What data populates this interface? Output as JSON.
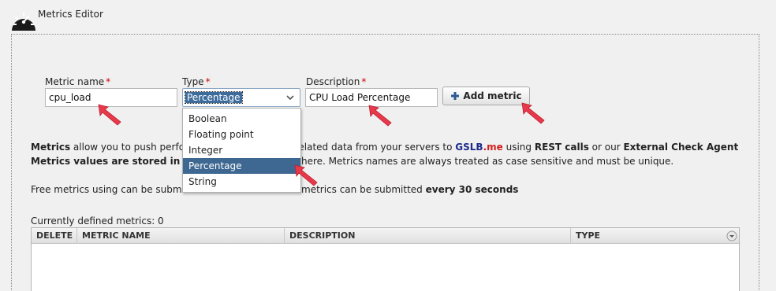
{
  "app": {
    "title": "Metrics Editor",
    "icon": "gauge-icon"
  },
  "form": {
    "metric_name": {
      "label": "Metric name",
      "required_mark": "*",
      "value": "cpu_load"
    },
    "type": {
      "label": "Type",
      "required_mark": "*",
      "value": "Percentage",
      "options": [
        "Boolean",
        "Floating point",
        "Integer",
        "Percentage",
        "String"
      ],
      "selected_option": "Percentage"
    },
    "description": {
      "label": "Description",
      "required_mark": "*",
      "value": "CPU Load Percentage"
    },
    "add_button": {
      "label": "Add metric",
      "icon": "plus-icon"
    }
  },
  "info": {
    "line1": {
      "a": "Metrics",
      "b": " allow you to push performa",
      "c": "e-related data from your servers to ",
      "brand1": "GSLB",
      "brand2": ".me",
      "d": " using ",
      "e": "REST calls",
      "f": " or our ",
      "g": "External Check Agent"
    },
    "line2": {
      "a": "Metrics values are stored in variab",
      "b": "here. Metrics names are always treated as case sensitive and must be unique."
    },
    "line3": {
      "a": "Free metrics using can be submitted",
      "b": "metrics can be submitted ",
      "c": "every 30 seconds"
    }
  },
  "table": {
    "count_label": "Currently defined metrics: 0",
    "columns": [
      "DELETE",
      "METRIC NAME",
      "DESCRIPTION",
      "TYPE"
    ],
    "rows": []
  },
  "colors": {
    "selection": "#3e6891",
    "required": "#cc0000",
    "brand_blue": "#1b2a8a",
    "brand_red": "#d21d1d",
    "arrow": "#e8394b"
  }
}
